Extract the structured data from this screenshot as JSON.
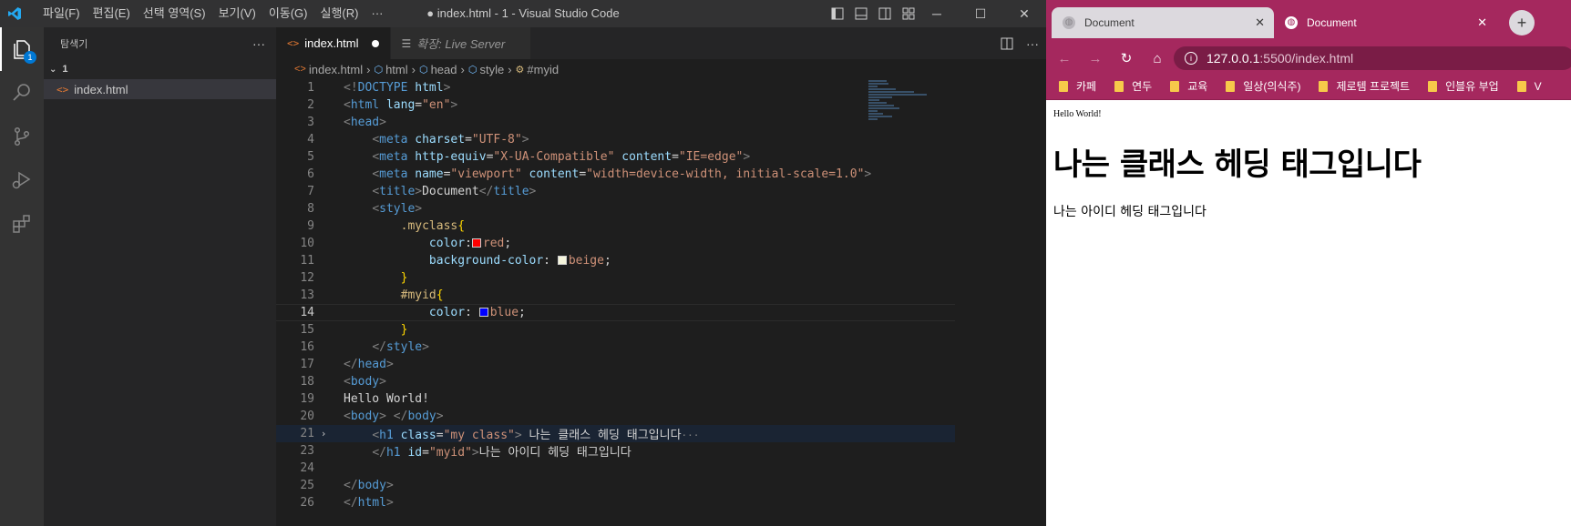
{
  "vscode": {
    "menu": [
      "파일(F)",
      "편집(E)",
      "선택 영역(S)",
      "보기(V)",
      "이동(G)",
      "실행(R)",
      "···"
    ],
    "window_title": "● index.html - 1 - Visual Studio Code",
    "activity_badge": "1",
    "sidebar": {
      "title": "탐색기",
      "more": "···",
      "folder": "1",
      "file": "index.html"
    },
    "tabs": [
      {
        "label": "index.html",
        "active": true,
        "dirty": true
      },
      {
        "label": "확장: Live Server",
        "active": false
      }
    ],
    "breadcrumb": [
      "index.html",
      "html",
      "head",
      "style",
      "#myid"
    ],
    "code": {
      "current_line": 14,
      "lines": [
        {
          "n": "1",
          "html": "<span class='p'>&lt;!</span><span class='t'>DOCTYPE</span> <span class='a'>html</span><span class='p'>&gt;</span>"
        },
        {
          "n": "2",
          "html": "<span class='p'>&lt;</span><span class='t'>html</span> <span class='a'>lang</span>=<span class='s'>\"en\"</span><span class='p'>&gt;</span>"
        },
        {
          "n": "3",
          "html": "<span class='p'>&lt;</span><span class='t'>head</span><span class='p'>&gt;</span>"
        },
        {
          "n": "4",
          "html": "    <span class='p'>&lt;</span><span class='t'>meta</span> <span class='a'>charset</span>=<span class='s'>\"UTF-8\"</span><span class='p'>&gt;</span>"
        },
        {
          "n": "5",
          "html": "    <span class='p'>&lt;</span><span class='t'>meta</span> <span class='a'>http-equiv</span>=<span class='s'>\"X-UA-Compatible\"</span> <span class='a'>content</span>=<span class='s'>\"IE=edge\"</span><span class='p'>&gt;</span>"
        },
        {
          "n": "6",
          "html": "    <span class='p'>&lt;</span><span class='t'>meta</span> <span class='a'>name</span>=<span class='s'>\"viewport\"</span> <span class='a'>content</span>=<span class='s'>\"width=device-width, initial-scale=1.0\"</span><span class='p'>&gt;</span>"
        },
        {
          "n": "7",
          "html": "    <span class='p'>&lt;</span><span class='t'>title</span><span class='p'>&gt;</span>Document<span class='p'>&lt;/</span><span class='t'>title</span><span class='p'>&gt;</span>"
        },
        {
          "n": "8",
          "html": "    <span class='p'>&lt;</span><span class='t'>style</span><span class='p'>&gt;</span>"
        },
        {
          "n": "9",
          "html": "        <span class='sel'>.myclass</span><span class='br'>{</span>"
        },
        {
          "n": "10",
          "html": "            <span class='pn'>color</span>:<span class='sw' style='background:#ff0000'></span><span class='v'>red</span>;"
        },
        {
          "n": "11",
          "html": "            <span class='pn'>background-color</span>: <span class='sw' style='background:#f5f5dc'></span><span class='v'>beige</span>;"
        },
        {
          "n": "12",
          "html": "        <span class='br'>}</span>"
        },
        {
          "n": "13",
          "html": "        <span class='sel'>#myid</span><span class='br'>{</span>"
        },
        {
          "n": "14",
          "html": "            <span class='pn'>color</span>: <span class='sw' style='background:#0000ff'></span><span class='v'>blue</span>;"
        },
        {
          "n": "15",
          "html": "        <span class='br'>}</span>"
        },
        {
          "n": "16",
          "html": "    <span class='p'>&lt;/</span><span class='t'>style</span><span class='p'>&gt;</span>"
        },
        {
          "n": "17",
          "html": "<span class='p'>&lt;/</span><span class='t'>head</span><span class='p'>&gt;</span>"
        },
        {
          "n": "18",
          "html": "<span class='p'>&lt;</span><span class='t'>body</span><span class='p'>&gt;</span>"
        },
        {
          "n": "19",
          "html": "Hello World!"
        },
        {
          "n": "20",
          "html": "<span class='p'>&lt;</span><span class='t'>body</span><span class='p'>&gt;</span> <span class='p'>&lt;/</span><span class='t'>body</span><span class='p'>&gt;</span>"
        },
        {
          "n": "21",
          "fold": "›",
          "folded": true,
          "html": "    <span class='p'>&lt;</span><span class='t'>h1</span> <span class='a'>class</span>=<span class='s'>\"my class\"</span><span class='p'>&gt;</span> 나는 클래스 헤딩 태그입니다<span class='ellip'>···</span>"
        },
        {
          "n": "23",
          "html": "    <span class='p'>&lt;/</span><span class='t'>h1</span> <span class='a'>id</span>=<span class='s'>\"myid\"</span><span class='p'>&gt;</span>나는 아이디 헤딩 태그입니다"
        },
        {
          "n": "24",
          "html": ""
        },
        {
          "n": "25",
          "html": "<span class='p'>&lt;/</span><span class='t'>body</span><span class='p'>&gt;</span>"
        },
        {
          "n": "26",
          "html": "<span class='p'>&lt;/</span><span class='t'>html</span><span class='p'>&gt;</span>"
        }
      ]
    }
  },
  "browser": {
    "tabs": [
      {
        "label": "Document",
        "active": false
      },
      {
        "label": "Document",
        "active": true
      }
    ],
    "close_label": "✕",
    "new_tab": "+",
    "url_host": "127.0.0.1",
    "url_rest": ":5500/index.html",
    "bookmarks": [
      "카페",
      "연두",
      "교육",
      "일상(의식주)",
      "제로템 프로젝트",
      "인블유 부업",
      "V"
    ],
    "page": {
      "hello": "Hello World!",
      "h1": "나는 클래스 헤딩 태그입니다",
      "id_heading": "나는 아이디 헤딩 태그입니다"
    },
    "accent": "#a5285e"
  }
}
